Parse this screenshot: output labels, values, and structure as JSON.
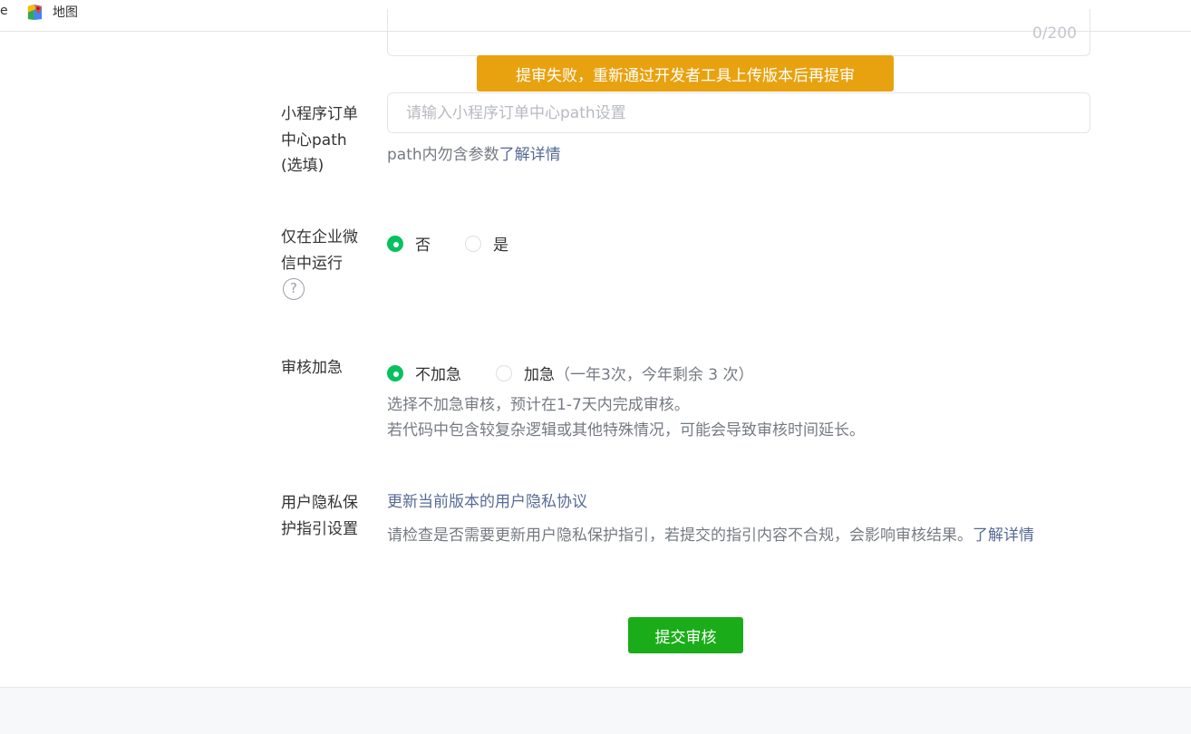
{
  "bookmarks": {
    "truncated_label": "e",
    "items": [
      {
        "label": "地图",
        "icon": "google-maps-icon"
      }
    ]
  },
  "textarea": {
    "counter": "0/200"
  },
  "toast": {
    "text": "提审失败，重新通过开发者工具上传版本后再提审"
  },
  "order_path": {
    "label_lines": [
      "小程序订单",
      "中心path",
      "(选填)"
    ],
    "placeholder": "请输入小程序订单中心path设置",
    "value": "",
    "tip": "path内勿含参数",
    "tip_link": "了解详情"
  },
  "wecom_only": {
    "label_lines": [
      "仅在企业微",
      "信中运行"
    ],
    "help_icon": "question-mark-icon",
    "help_glyph": "?",
    "options": [
      {
        "label": "否",
        "checked": true
      },
      {
        "label": "是",
        "checked": false
      }
    ]
  },
  "expedite": {
    "label": "审核加急",
    "options": [
      {
        "label": "不加急",
        "checked": true
      },
      {
        "label": "加急",
        "note": "（一年3次，今年剩余 3 次）",
        "checked": false
      }
    ],
    "tips": [
      "选择不加急审核，预计在1-7天内完成审核。",
      "若代码中包含较复杂逻辑或其他特殊情况，可能会导致审核时间延长。"
    ]
  },
  "privacy": {
    "label_lines": [
      "用户隐私保",
      "护指引设置"
    ],
    "update_link": "更新当前版本的用户隐私协议",
    "tip": "请检查是否需要更新用户隐私保护指引，若提交的指引内容不合规，会影响审核结果。",
    "tip_link": "了解详情"
  },
  "submit": {
    "label": "提交审核"
  },
  "colors": {
    "primary_green": "#1aad19",
    "radio_green": "#07c160",
    "toast_orange": "#e8a20f",
    "link_blue": "#576b95"
  }
}
